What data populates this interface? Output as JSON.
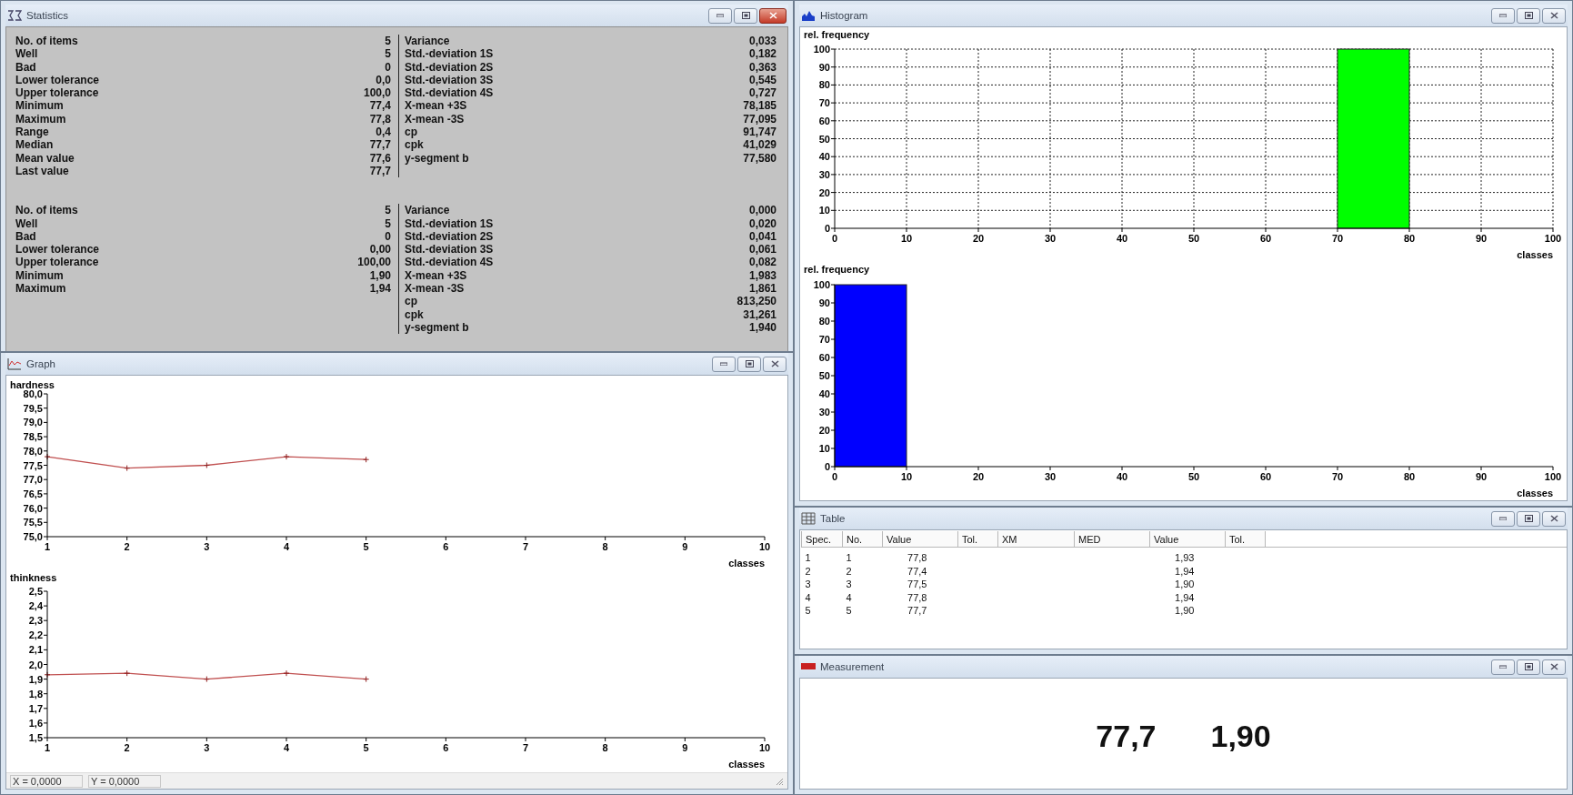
{
  "statistics": {
    "title": "Statistics",
    "active": true,
    "blocks": [
      {
        "left": [
          {
            "label": "No. of items",
            "value": "5"
          },
          {
            "label": "Well",
            "value": "5"
          },
          {
            "label": "Bad",
            "value": "0"
          },
          {
            "label": "Lower tolerance",
            "value": "0,0"
          },
          {
            "label": "Upper tolerance",
            "value": "100,0"
          },
          {
            "label": "Minimum",
            "value": "77,4"
          },
          {
            "label": "Maximum",
            "value": "77,8"
          },
          {
            "label": "Range",
            "value": "0,4"
          },
          {
            "label": "Median",
            "value": "77,7"
          },
          {
            "label": "Mean value",
            "value": "77,6"
          },
          {
            "label": "Last value",
            "value": "77,7"
          }
        ],
        "right": [
          {
            "label": "Variance",
            "value": "0,033"
          },
          {
            "label": "Std.-deviation 1S",
            "value": "0,182"
          },
          {
            "label": "Std.-deviation 2S",
            "value": "0,363"
          },
          {
            "label": "Std.-deviation 3S",
            "value": "0,545"
          },
          {
            "label": "Std.-deviation 4S",
            "value": "0,727"
          },
          {
            "label": "X-mean +3S",
            "value": "78,185"
          },
          {
            "label": "X-mean -3S",
            "value": "77,095"
          },
          {
            "label": "cp",
            "value": "91,747"
          },
          {
            "label": "cpk",
            "value": "41,029"
          },
          {
            "label": "y-segment b",
            "value": "77,580"
          }
        ]
      },
      {
        "left": [
          {
            "label": "No. of items",
            "value": "5"
          },
          {
            "label": "Well",
            "value": "5"
          },
          {
            "label": "Bad",
            "value": "0"
          },
          {
            "label": "Lower tolerance",
            "value": "0,00"
          },
          {
            "label": "Upper tolerance",
            "value": "100,00"
          },
          {
            "label": "Minimum",
            "value": "1,90"
          },
          {
            "label": "Maximum",
            "value": "1,94"
          }
        ],
        "right": [
          {
            "label": "Variance",
            "value": "0,000"
          },
          {
            "label": "Std.-deviation 1S",
            "value": "0,020"
          },
          {
            "label": "Std.-deviation 2S",
            "value": "0,041"
          },
          {
            "label": "Std.-deviation 3S",
            "value": "0,061"
          },
          {
            "label": "Std.-deviation 4S",
            "value": "0,082"
          },
          {
            "label": "X-mean +3S",
            "value": "1,983"
          },
          {
            "label": "X-mean -3S",
            "value": "1,861"
          },
          {
            "label": "cp",
            "value": "813,250"
          },
          {
            "label": "cpk",
            "value": "31,261"
          },
          {
            "label": "y-segment b",
            "value": "1,940"
          }
        ]
      }
    ]
  },
  "histogram": {
    "title": "Histogram",
    "active": false,
    "charts": [
      {
        "chart_data": {
          "grid": true,
          "type": "bar",
          "ylabel": "rel. frequency",
          "xlabel": "classes",
          "x": [
            5,
            15,
            25,
            35,
            45,
            55,
            65,
            75,
            85,
            95
          ],
          "series": [
            {
              "color": "#00ff00",
              "values": [
                0,
                0,
                0,
                0,
                0,
                0,
                0,
                100,
                0,
                0
              ]
            }
          ],
          "xlim": [
            0,
            100
          ],
          "ylim": [
            0,
            100
          ],
          "xticks": [
            0,
            10,
            20,
            30,
            40,
            50,
            60,
            70,
            80,
            90,
            100
          ],
          "yticks": [
            0,
            10,
            20,
            30,
            40,
            50,
            60,
            70,
            80,
            90,
            100
          ]
        }
      },
      {
        "chart_data": {
          "type": "bar",
          "ylabel": "rel. frequency",
          "xlabel": "classes",
          "x": [
            5,
            15,
            25,
            35,
            45,
            55,
            65,
            75,
            85,
            95
          ],
          "series": [
            {
              "color": "#0000ff",
              "values": [
                100,
                0,
                0,
                0,
                0,
                0,
                0,
                0,
                0,
                0
              ]
            }
          ],
          "xlim": [
            0,
            100
          ],
          "ylim": [
            0,
            100
          ],
          "xticks": [
            0,
            10,
            20,
            30,
            40,
            50,
            60,
            70,
            80,
            90,
            100
          ],
          "yticks": [
            0,
            10,
            20,
            30,
            40,
            50,
            60,
            70,
            80,
            90,
            100
          ]
        }
      }
    ]
  },
  "graph": {
    "title": "Graph",
    "active": false,
    "charts": [
      {
        "chart_data": {
          "type": "line",
          "ylabel": "hardness",
          "xlabel": "classes",
          "x": [
            1,
            2,
            3,
            4,
            5
          ],
          "series": [
            {
              "color": "#c05050",
              "marker": "+",
              "values": [
                77.8,
                77.4,
                77.5,
                77.8,
                77.7
              ]
            }
          ],
          "xlim": [
            1,
            10
          ],
          "ylim": [
            75,
            80
          ],
          "xticks": [
            1,
            2,
            3,
            4,
            5,
            6,
            7,
            8,
            9,
            10
          ],
          "yticks": [
            {
              "value": 75,
              "label": "75,0"
            },
            {
              "value": 75.5,
              "label": "75,5"
            },
            {
              "value": 76,
              "label": "76,0"
            },
            {
              "value": 76.5,
              "label": "76,5"
            },
            {
              "value": 77,
              "label": "77,0"
            },
            {
              "value": 77.5,
              "label": "77,5"
            },
            {
              "value": 78,
              "label": "78,0"
            },
            {
              "value": 78.5,
              "label": "78,5"
            },
            {
              "value": 79,
              "label": "79,0"
            },
            {
              "value": 79.5,
              "label": "79,5"
            },
            {
              "value": 80,
              "label": "80,0"
            }
          ]
        }
      },
      {
        "chart_data": {
          "type": "line",
          "ylabel": "thinkness",
          "xlabel": "classes",
          "x": [
            1,
            2,
            3,
            4,
            5
          ],
          "series": [
            {
              "color": "#c05050",
              "marker": "+",
              "values": [
                1.93,
                1.94,
                1.9,
                1.94,
                1.9
              ]
            }
          ],
          "xlim": [
            1,
            10
          ],
          "ylim": [
            1.5,
            2.5
          ],
          "xticks": [
            1,
            2,
            3,
            4,
            5,
            6,
            7,
            8,
            9,
            10
          ],
          "yticks": [
            {
              "value": 1.5,
              "label": "1,5"
            },
            {
              "value": 1.6,
              "label": "1,6"
            },
            {
              "value": 1.7,
              "label": "1,7"
            },
            {
              "value": 1.8,
              "label": "1,8"
            },
            {
              "value": 1.9,
              "label": "1,9"
            },
            {
              "value": 2.0,
              "label": "2,0"
            },
            {
              "value": 2.1,
              "label": "2,1"
            },
            {
              "value": 2.2,
              "label": "2,2"
            },
            {
              "value": 2.3,
              "label": "2,3"
            },
            {
              "value": 2.4,
              "label": "2,4"
            },
            {
              "value": 2.5,
              "label": "2,5"
            }
          ]
        }
      }
    ],
    "status_bar": [
      "X = 0,0000",
      "Y = 0,0000"
    ]
  },
  "table": {
    "title": "Table",
    "active": false,
    "columns": [
      "Spec.",
      "No.",
      "Value",
      "Tol.",
      "XM",
      "MED",
      "Value",
      "Tol."
    ],
    "rows": [
      [
        "1",
        "1",
        "77,8",
        null,
        null,
        null,
        "1,93",
        null
      ],
      [
        "2",
        "2",
        "77,4",
        null,
        null,
        null,
        "1,94",
        null
      ],
      [
        "3",
        "3",
        "77,5",
        null,
        null,
        null,
        "1,90",
        null
      ],
      [
        "4",
        "4",
        "77,8",
        null,
        null,
        null,
        "1,94",
        null
      ],
      [
        "5",
        "5",
        "77,7",
        null,
        null,
        null,
        "1,90",
        null
      ]
    ]
  },
  "measurement": {
    "title": "Measurement",
    "active": false,
    "values": [
      "77,7",
      "1,90"
    ]
  }
}
